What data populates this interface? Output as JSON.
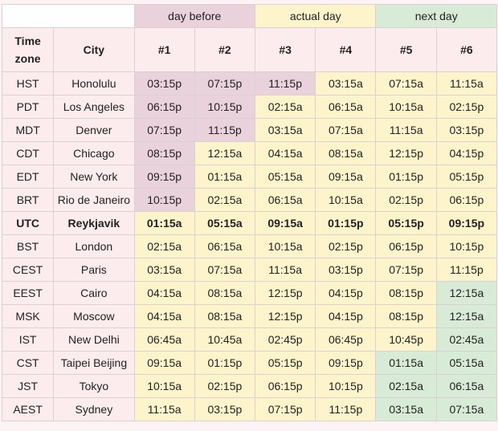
{
  "colors": {
    "day_before": "#e9d2db",
    "actual_day": "#fef4cc",
    "next_day": "#d7ebd7",
    "base": "#fdecee"
  },
  "header": {
    "groups": [
      "day before",
      "actual day",
      "next day"
    ],
    "columns": [
      "Time zone",
      "City",
      "#1",
      "#2",
      "#3",
      "#4",
      "#5",
      "#6"
    ]
  },
  "rows": [
    {
      "tz": "HST",
      "city": "Honolulu",
      "times": [
        "03:15p",
        "07:15p",
        "11:15p",
        "03:15a",
        "07:15a",
        "11:15a"
      ],
      "cls": [
        "d",
        "d",
        "d",
        "a",
        "a",
        "a"
      ]
    },
    {
      "tz": "PDT",
      "city": "Los Angeles",
      "times": [
        "06:15p",
        "10:15p",
        "02:15a",
        "06:15a",
        "10:15a",
        "02:15p"
      ],
      "cls": [
        "d",
        "d",
        "a",
        "a",
        "a",
        "a"
      ]
    },
    {
      "tz": "MDT",
      "city": "Denver",
      "times": [
        "07:15p",
        "11:15p",
        "03:15a",
        "07:15a",
        "11:15a",
        "03:15p"
      ],
      "cls": [
        "d",
        "d",
        "a",
        "a",
        "a",
        "a"
      ]
    },
    {
      "tz": "CDT",
      "city": "Chicago",
      "times": [
        "08:15p",
        "12:15a",
        "04:15a",
        "08:15a",
        "12:15p",
        "04:15p"
      ],
      "cls": [
        "d",
        "a",
        "a",
        "a",
        "a",
        "a"
      ]
    },
    {
      "tz": "EDT",
      "city": "New York",
      "times": [
        "09:15p",
        "01:15a",
        "05:15a",
        "09:15a",
        "01:15p",
        "05:15p"
      ],
      "cls": [
        "d",
        "a",
        "a",
        "a",
        "a",
        "a"
      ]
    },
    {
      "tz": "BRT",
      "city": "Rio de Janeiro",
      "times": [
        "10:15p",
        "02:15a",
        "06:15a",
        "10:15a",
        "02:15p",
        "06:15p"
      ],
      "cls": [
        "d",
        "a",
        "a",
        "a",
        "a",
        "a"
      ]
    },
    {
      "tz": "UTC",
      "city": "Reykjavik",
      "times": [
        "01:15a",
        "05:15a",
        "09:15a",
        "01:15p",
        "05:15p",
        "09:15p"
      ],
      "cls": [
        "a",
        "a",
        "a",
        "a",
        "a",
        "a"
      ],
      "bold": true
    },
    {
      "tz": "BST",
      "city": "London",
      "times": [
        "02:15a",
        "06:15a",
        "10:15a",
        "02:15p",
        "06:15p",
        "10:15p"
      ],
      "cls": [
        "a",
        "a",
        "a",
        "a",
        "a",
        "a"
      ]
    },
    {
      "tz": "CEST",
      "city": "Paris",
      "times": [
        "03:15a",
        "07:15a",
        "11:15a",
        "03:15p",
        "07:15p",
        "11:15p"
      ],
      "cls": [
        "a",
        "a",
        "a",
        "a",
        "a",
        "a"
      ]
    },
    {
      "tz": "EEST",
      "city": "Cairo",
      "times": [
        "04:15a",
        "08:15a",
        "12:15p",
        "04:15p",
        "08:15p",
        "12:15a"
      ],
      "cls": [
        "a",
        "a",
        "a",
        "a",
        "a",
        "n"
      ]
    },
    {
      "tz": "MSK",
      "city": "Moscow",
      "times": [
        "04:15a",
        "08:15a",
        "12:15p",
        "04:15p",
        "08:15p",
        "12:15a"
      ],
      "cls": [
        "a",
        "a",
        "a",
        "a",
        "a",
        "n"
      ]
    },
    {
      "tz": "IST",
      "city": "New Delhi",
      "times": [
        "06:45a",
        "10:45a",
        "02:45p",
        "06:45p",
        "10:45p",
        "02:45a"
      ],
      "cls": [
        "a",
        "a",
        "a",
        "a",
        "a",
        "n"
      ]
    },
    {
      "tz": "CST",
      "city": "Taipei Beijing",
      "times": [
        "09:15a",
        "01:15p",
        "05:15p",
        "09:15p",
        "01:15a",
        "05:15a"
      ],
      "cls": [
        "a",
        "a",
        "a",
        "a",
        "n",
        "n"
      ]
    },
    {
      "tz": "JST",
      "city": "Tokyo",
      "times": [
        "10:15a",
        "02:15p",
        "06:15p",
        "10:15p",
        "02:15a",
        "06:15a"
      ],
      "cls": [
        "a",
        "a",
        "a",
        "a",
        "n",
        "n"
      ]
    },
    {
      "tz": "AEST",
      "city": "Sydney",
      "times": [
        "11:15a",
        "03:15p",
        "07:15p",
        "11:15p",
        "03:15a",
        "07:15a"
      ],
      "cls": [
        "a",
        "a",
        "a",
        "a",
        "n",
        "n"
      ]
    }
  ]
}
